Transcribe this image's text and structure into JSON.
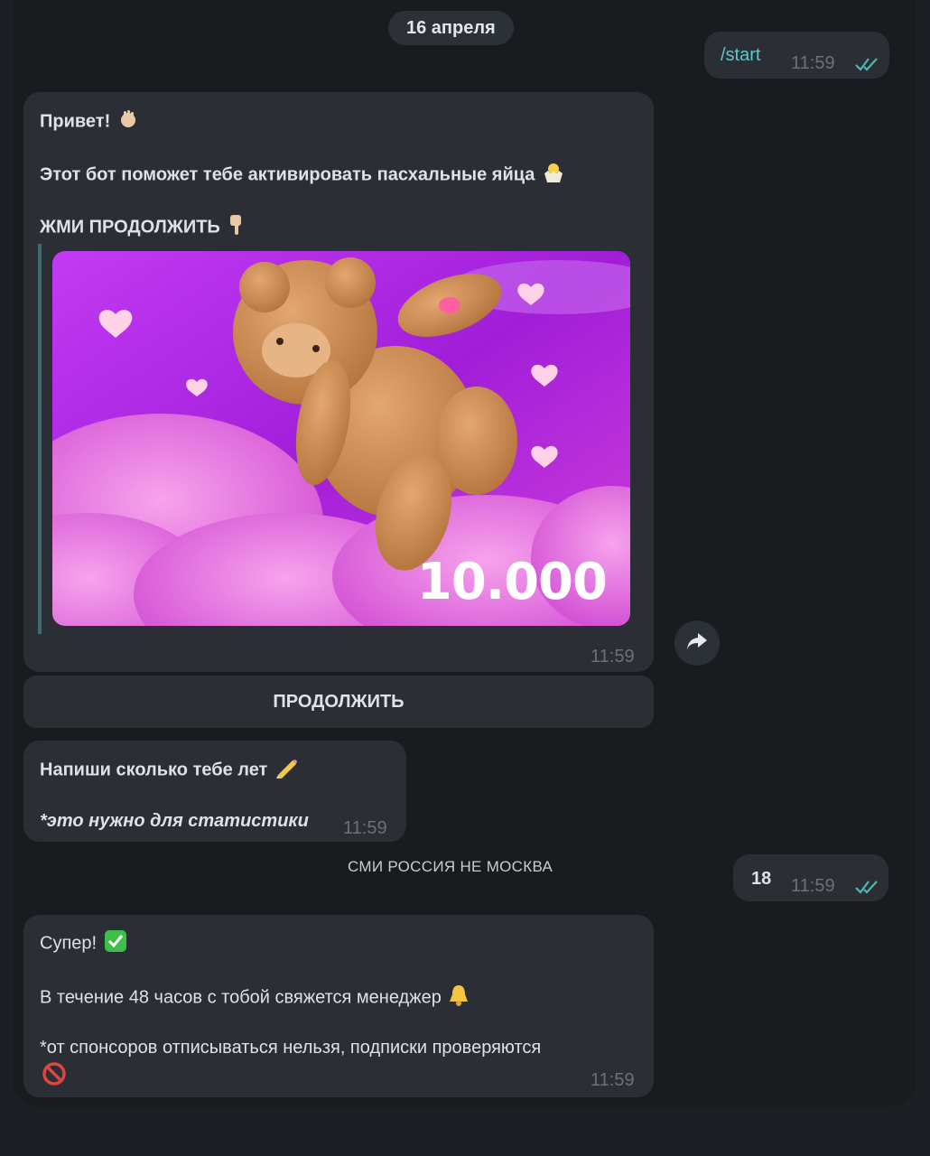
{
  "date_label": "16 апреля",
  "messages": {
    "start": {
      "text": "/start",
      "time": "11:59"
    },
    "welcome": {
      "line1": "Привет!",
      "line2": "Этот бот поможет тебе активировать пасхальные яйца",
      "line3": "ЖМИ ПРОДОЛЖИТЬ",
      "promo_number": "10.000",
      "time": "11:59"
    },
    "continue_button": "ПРОДОЛЖИТЬ",
    "age": {
      "line1": "Напиши сколько тебе лет",
      "line2": "*это нужно для статистики",
      "time": "11:59"
    },
    "age_reply": {
      "text": "18",
      "time": "11:59"
    },
    "final": {
      "line1": "Супер!",
      "line2": "В течение 48 часов с тобой свяжется менеджер",
      "line3": "*от спонсоров отписываться нельзя, подписки проверяются",
      "time": "11:59"
    }
  },
  "watermark": "СМИ РОССИЯ НЕ МОСКВА",
  "icons": {
    "wave": "waving-hand-icon",
    "chick": "hatching-chick-icon",
    "point_down": "pointing-down-icon",
    "pencil": "pencil-icon",
    "check": "check-mark-button-icon",
    "bell": "bell-icon",
    "prohibited": "prohibited-icon",
    "share": "share-arrow-icon",
    "read": "double-check-icon"
  },
  "colors": {
    "background": "#191b1f",
    "bubble": "#2b2e34",
    "command_link": "#5fc6c9",
    "read_check": "#4fb7b3"
  }
}
